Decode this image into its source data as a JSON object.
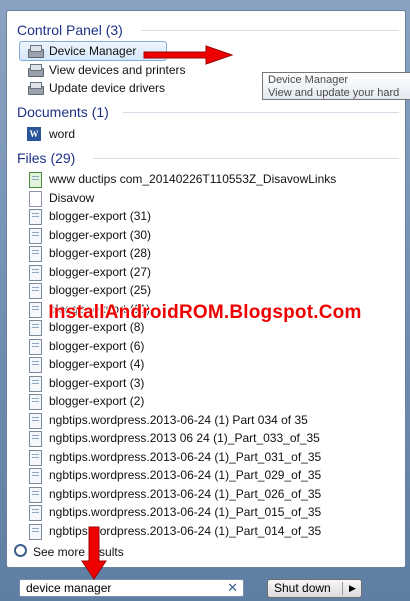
{
  "sections": {
    "control_panel": {
      "header": "Control Panel (3)",
      "items": [
        "Device Manager",
        "View devices and printers",
        "Update device drivers"
      ]
    },
    "documents": {
      "header": "Documents (1)",
      "items": [
        "word"
      ]
    },
    "files": {
      "header": "Files (29)",
      "items": [
        "www  ductips  com_20140226T110553Z_DisavowLinks",
        "Disavow",
        "blogger-export (31)",
        "blogger-export (30)",
        "blogger-export (28)",
        "blogger-export (27)",
        "blogger-export (25)",
        "blogger-export (11)",
        "blogger-export (8)",
        "blogger-export (6)",
        "blogger-export (4)",
        "blogger-export (3)",
        "blogger-export (2)",
        "ngbtips.wordpress.2013-06-24 (1)  Part 034  of  35",
        "ngbtips.wordpress.2013 06 24 (1)_Part_033_of_35",
        "ngbtips.wordpress.2013-06-24 (1)_Part_031_of_35",
        "ngbtips.wordpress.2013-06-24 (1)_Part_029_of_35",
        "ngbtips.wordpress.2013-06-24 (1)_Part_026_of_35",
        "ngbtips.wordpress.2013-06-24 (1)_Part_015_of_35",
        "ngbtips.wordpress.2013-06-24 (1)_Part_014_of_35"
      ]
    }
  },
  "tooltip": {
    "title": "Device Manager",
    "description": "View and update your hard"
  },
  "watermark": "InstallAndroidROM.Blogspot.Com",
  "see_more": "See more results",
  "search": {
    "value": "device manager",
    "clear_icon": "✕"
  },
  "shutdown": {
    "label": "Shut down",
    "arrow": "▶"
  },
  "colors": {
    "section_header": "#1e3287",
    "annotation_red": "#ee0000",
    "selection_border": "#84acdd"
  },
  "icons": {
    "device_manager": "device-manager-icon",
    "printers": "printer-icon",
    "update_drivers": "driver-update-icon",
    "word": "word-document-icon",
    "file": "text-file-icon",
    "search": "magnifier-icon"
  }
}
